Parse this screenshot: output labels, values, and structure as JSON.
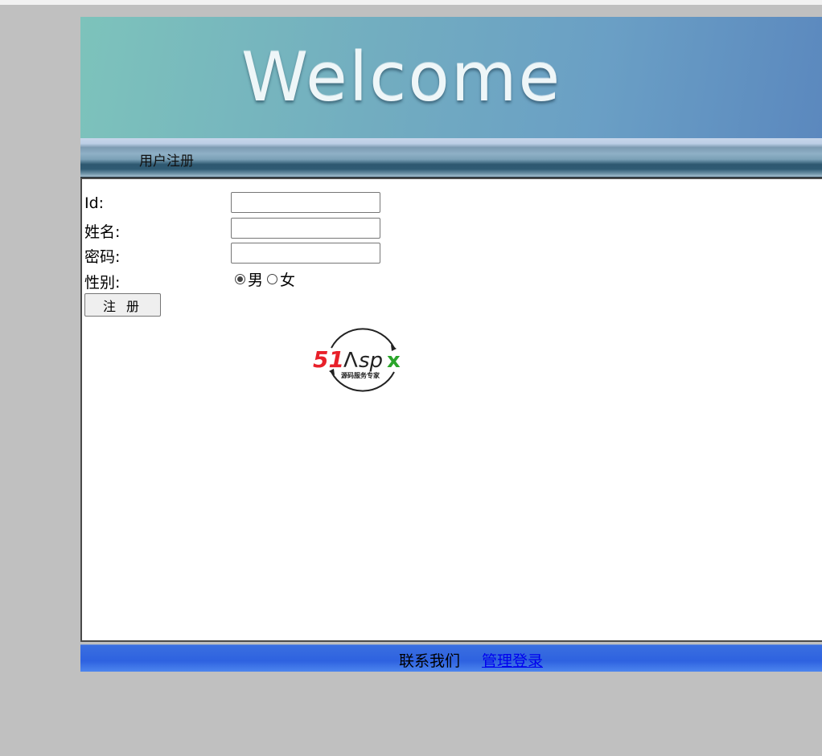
{
  "banner": {
    "text": "Welcome"
  },
  "nav": {
    "title": "用户注册"
  },
  "form": {
    "id_label": "Id:",
    "name_label": "姓名:",
    "password_label": "密码:",
    "gender_label": "性别:",
    "gender_options": [
      {
        "label": "男",
        "selected": true
      },
      {
        "label": "女",
        "selected": false
      }
    ],
    "id_value": "",
    "name_value": "",
    "password_value": "",
    "submit_label": "注 册"
  },
  "logo": {
    "brand_51": "51",
    "brand_a": "Λ",
    "brand_sp": "sp",
    "brand_x": "x",
    "tagline": "源码服务专家",
    "colors": {
      "red": "#e8202a",
      "dark": "#222222",
      "green": "#2aa52a"
    }
  },
  "footer": {
    "contact": "联系我们",
    "admin_login": "管理登录"
  }
}
